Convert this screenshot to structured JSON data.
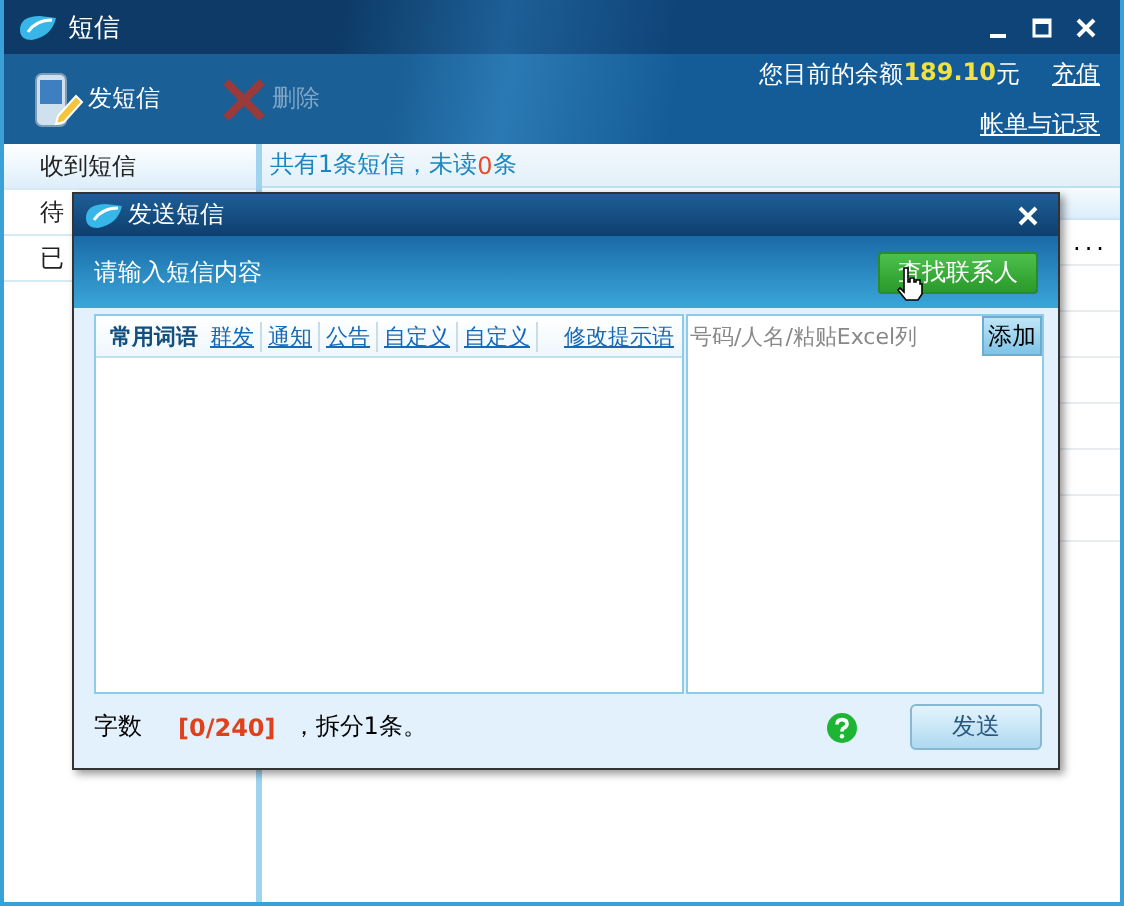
{
  "window": {
    "title": "短信"
  },
  "toolbar": [
    {
      "kind": "send",
      "label": "发短信",
      "disabled": false
    },
    {
      "kind": "delete",
      "label": "删除",
      "disabled": true
    }
  ],
  "balance": {
    "prefix": "您目前的余额",
    "amount": "189.10",
    "unit": "元"
  },
  "links": [
    "充值",
    "帐单与记录"
  ],
  "sidebar": {
    "items": [
      {
        "label": "收到短信",
        "selected": true
      },
      {
        "label": "待",
        "selected": false
      },
      {
        "label": "已",
        "selected": false
      }
    ]
  },
  "summary": {
    "before": "共有1条短信，未读",
    "count": "0",
    "after": "条"
  },
  "list_rows": [
    {
      "text": "..."
    }
  ],
  "dialog": {
    "title": "发送短信",
    "prompt": "请输入短信内容",
    "find_button": "查找联系人",
    "tabs": [
      {
        "label": "常用词语",
        "selected": true
      },
      {
        "label": "群发",
        "selected": false
      },
      {
        "label": "通知",
        "selected": false
      },
      {
        "label": "公告",
        "selected": false
      },
      {
        "label": "自定义",
        "selected": false
      },
      {
        "label": "自定义",
        "selected": false
      }
    ],
    "edit_link": "修改提示语",
    "recipient": {
      "placeholder": "号码/人名/粘贴Excel列"
    },
    "add_button": "添加",
    "counter": {
      "label": "字数",
      "count": "[0/240]",
      "split": "，拆分1条。"
    },
    "send_button": "发送"
  }
}
